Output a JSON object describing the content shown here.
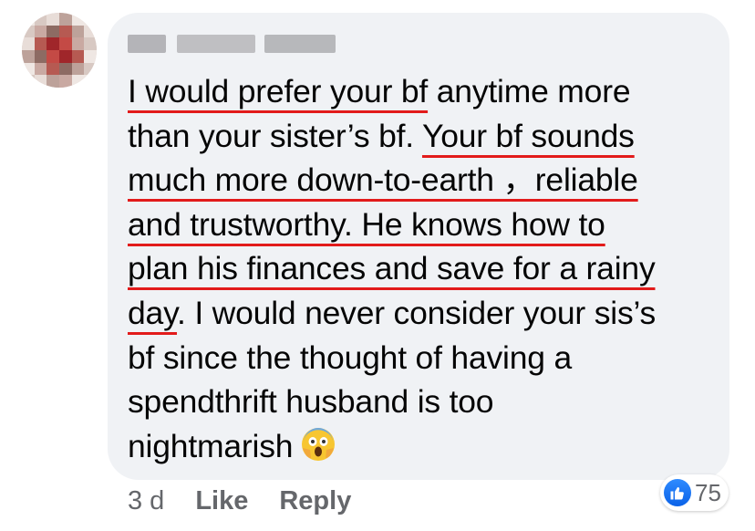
{
  "comment": {
    "author": "",
    "lines": [
      [
        {
          "text": "I would prefer your bf",
          "u": true
        },
        {
          "text": " anytime more",
          "u": false
        }
      ],
      [
        {
          "text": "than your sister’s bf. ",
          "u": false
        },
        {
          "text": "Your bf sounds",
          "u": true
        }
      ],
      [
        {
          "text": "much more down-to-earth ，reliable",
          "u": true
        }
      ],
      [
        {
          "text": "and trustworthy. He knows how to",
          "u": true
        }
      ],
      [
        {
          "text": "plan his finances and save for a rainy",
          "u": true
        }
      ],
      [
        {
          "text": "day",
          "u": true
        },
        {
          "text": ". I would never consider your sis’s",
          "u": false
        }
      ],
      [
        {
          "text": "bf since the thought of having a",
          "u": false
        }
      ],
      [
        {
          "text": "spendthrift husband is too",
          "u": false
        }
      ],
      [
        {
          "text": "nightmarish",
          "u": false
        }
      ]
    ],
    "emoji": "face-screaming-in-fear-emoji"
  },
  "reactions": {
    "icon": "thumbs-up-icon",
    "count": "75"
  },
  "meta": {
    "time": "3 d",
    "like_label": "Like",
    "reply_label": "Reply"
  },
  "colors": {
    "bubble": "#f0f2f5",
    "underline": "#e21b1b",
    "meta_text": "#65676b",
    "like_blue": "#1877f2"
  }
}
